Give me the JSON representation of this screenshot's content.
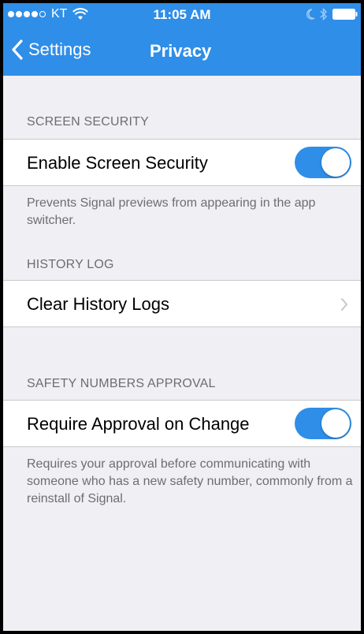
{
  "status_bar": {
    "carrier": "KT",
    "time": "11:05 AM",
    "signal_bars": 4,
    "signal_total": 5
  },
  "nav": {
    "back_label": "Settings",
    "title": "Privacy"
  },
  "sections": [
    {
      "header": "SCREEN SECURITY",
      "row_label": "Enable Screen Security",
      "toggle_on": true,
      "footer": "Prevents Signal previews from appearing in the app switcher."
    },
    {
      "header": "HISTORY LOG",
      "row_label": "Clear History Logs"
    },
    {
      "header": "SAFETY NUMBERS APPROVAL",
      "row_label": "Require Approval on Change",
      "toggle_on": true,
      "footer": "Requires your approval before communicating with someone who has a new safety number, commonly from a reinstall of Signal."
    }
  ],
  "colors": {
    "accent": "#2f8ee8",
    "background": "#efeff4",
    "secondary_text": "#6d6d72"
  }
}
